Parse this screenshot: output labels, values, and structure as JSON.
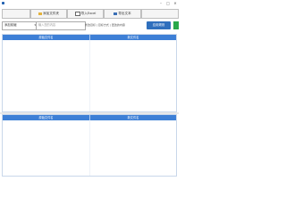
{
  "window": {
    "controls": {
      "minimize": "–",
      "maximize": "□",
      "close": "✕"
    }
  },
  "toolbar": {
    "buttons": [
      {
        "label": "",
        "icon": "blank-icon"
      },
      {
        "label": "添加文件夹",
        "icon": "folder-icon"
      },
      {
        "label": "导入Excel",
        "icon": "excel-icon"
      },
      {
        "label": "导出文本",
        "icon": "save-icon"
      },
      {
        "label": "",
        "icon": "blank-icon"
      }
    ]
  },
  "filter": {
    "mode_select": "添加前缀",
    "text_input_placeholder": "输入您的内容",
    "hint": "修改目标 | 目标方式 | 更改的内容",
    "run_button": "应用规则"
  },
  "top_grid": {
    "columns": [
      "原始文件名",
      "新文件名"
    ]
  },
  "bottom_grid": {
    "columns": [
      "原始文件名",
      "新文件名"
    ]
  },
  "colors": {
    "accent": "#3d7fd6",
    "run_button": "#2f6fbd",
    "go_button": "#2aa84a"
  }
}
